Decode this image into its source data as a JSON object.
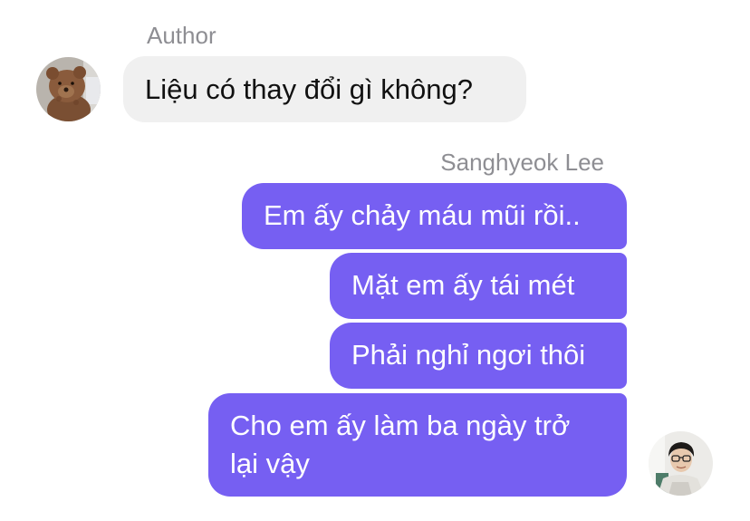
{
  "conversation": {
    "incoming": {
      "sender_name": "Author",
      "avatar_icon": "teddy-bear-avatar",
      "messages": [
        {
          "text": "Liệu có thay đổi gì không?"
        }
      ]
    },
    "outgoing": {
      "sender_name": "Sanghyeok Lee",
      "avatar_icon": "person-photo-avatar",
      "bubble_color": "#765ff2",
      "messages": [
        {
          "text": "Em ấy chảy máu mũi rồi.."
        },
        {
          "text": "Mặt em ấy tái mét"
        },
        {
          "text": "Phải nghỉ ngơi thôi"
        },
        {
          "text": "Cho em ấy làm ba ngày trở lại vậy"
        }
      ]
    }
  }
}
